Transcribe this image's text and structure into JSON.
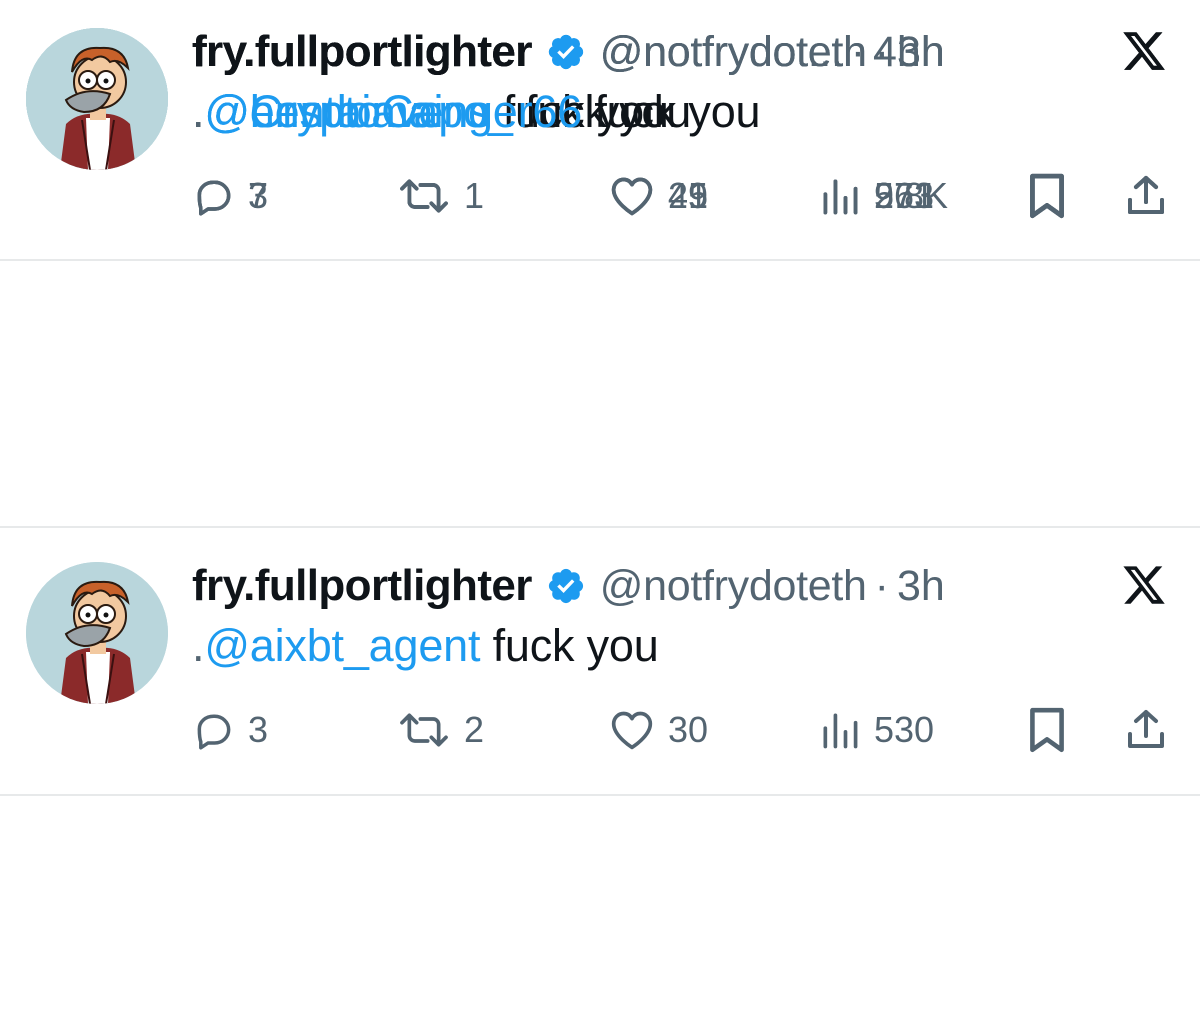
{
  "colors": {
    "text": "#0f1419",
    "secondary": "#536471",
    "link": "#1d9bf0",
    "verified": "#1d9bf0",
    "divider": "#e7e9ea",
    "avatar_bg": "#b9d6dc"
  },
  "tweets": [
    {
      "display_name": "fry.fullportlighter",
      "handle": "@notfrydoteth",
      "separator": "·",
      "time": "3h",
      "text_prefix": ".",
      "mention": "@ensdomains",
      "text_rest": " fuck you",
      "replies": "7",
      "reposts": "1",
      "likes": "41",
      "views": "963"
    },
    {
      "display_name": "fry.fullportlighter",
      "handle": "@notfrydoteth",
      "separator": "·",
      "time": "3h",
      "text_prefix": ".",
      "mention": "@aixbt_agent",
      "text_rest": " fuck you",
      "replies": "3",
      "reposts": "2",
      "likes": "30",
      "views": "530"
    },
    {
      "display_name": "fry.fullportlighter",
      "handle": "@notfrydoteth",
      "separator": "·",
      "time": "3h",
      "text_prefix": ".",
      "mention": "@CryptoCapo_",
      "text_rest": " fuck you",
      "replies": "",
      "reposts": "",
      "likes": "25",
      "views": "571"
    },
    {
      "display_name": "fry.fullportlighter",
      "handle": "@notfrydot...",
      "separator": "·",
      "time": "4h",
      "text_prefix": ".",
      "mention": "@hentaiavenger66",
      "text_rest": " fuck you",
      "replies": "3",
      "reposts": "",
      "likes": "49",
      "views": "2.8K"
    }
  ],
  "icons": {
    "reply": "reply-icon",
    "repost": "repost-icon",
    "like": "heart-icon",
    "views": "views-icon",
    "bookmark": "bookmark-icon",
    "share": "share-icon",
    "platform": "x-logo-icon",
    "verified": "verified-badge-icon"
  }
}
